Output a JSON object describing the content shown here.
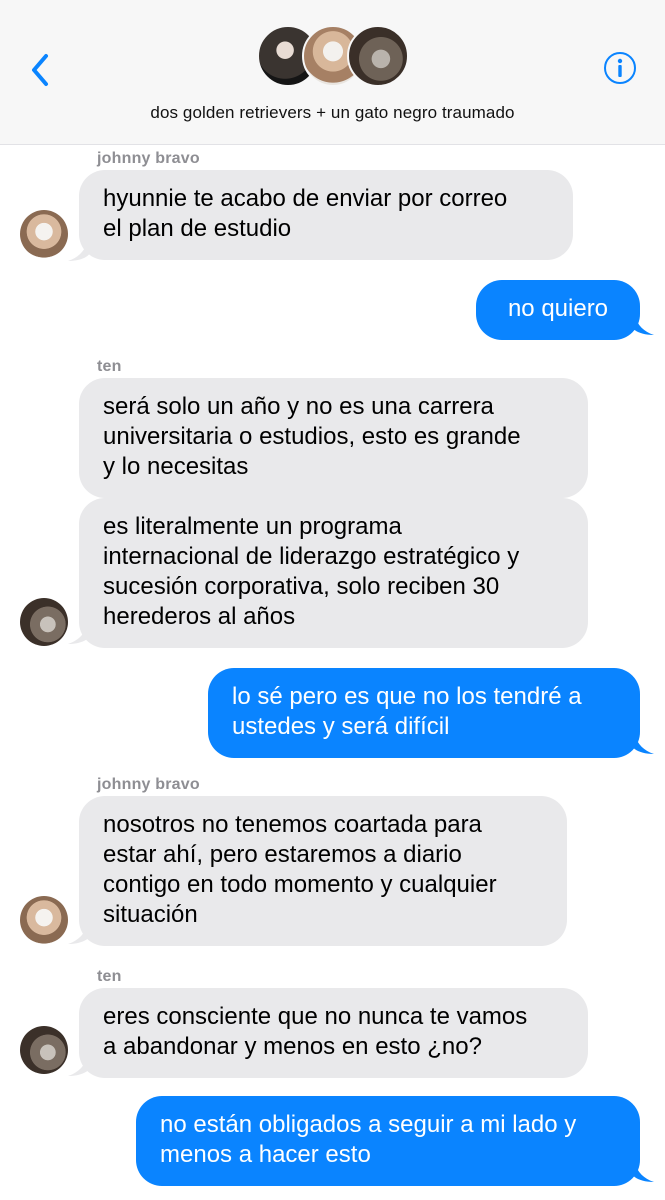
{
  "header": {
    "group_name": "dos golden retrievers + un gato negro traumado",
    "back_icon": "chevron-left-icon",
    "info_icon": "info-circle-icon",
    "accent": "#0a84ff"
  },
  "messages": [
    {
      "sender": "johnny bravo",
      "direction": "in",
      "lines": [
        "hyunnie te acabo de enviar por correo",
        "el plan de estudio"
      ]
    },
    {
      "direction": "out",
      "lines": [
        "no quiero"
      ]
    },
    {
      "sender": "ten",
      "direction": "in",
      "lines": [
        "será solo un año y no es una carrera",
        "universitaria o estudios, esto es grande",
        "y lo necesitas"
      ]
    },
    {
      "direction": "in",
      "lines": [
        "es literalmente un programa",
        "internacional de liderazgo estratégico y",
        "sucesión corporativa, solo reciben 30",
        "herederos al años"
      ]
    },
    {
      "direction": "out",
      "lines": [
        "lo sé pero es que no los tendré a",
        "ustedes y será difícil"
      ]
    },
    {
      "sender": "johnny bravo",
      "direction": "in",
      "lines": [
        "nosotros no tenemos coartada para",
        "estar ahí, pero estaremos a diario",
        "contigo en todo momento y cualquier",
        "situación"
      ]
    },
    {
      "sender": "ten",
      "direction": "in",
      "lines": [
        "eres consciente que no nunca te vamos",
        "a abandonar y menos en esto ¿no?"
      ]
    },
    {
      "direction": "out",
      "lines": [
        "no están obligados a seguir a mi lado y",
        "menos a hacer esto"
      ]
    }
  ],
  "colors": {
    "incoming_bubble": "#e9e9eb",
    "outgoing_bubble": "#0a84ff",
    "sender_label": "#8e8e93"
  }
}
